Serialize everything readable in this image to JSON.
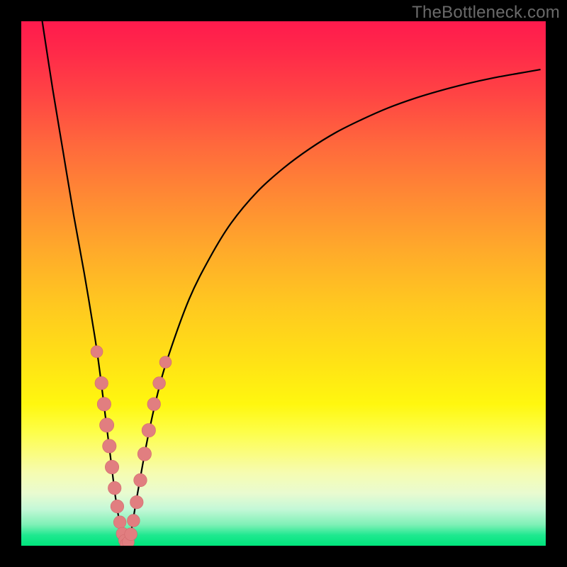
{
  "watermark": "TheBottleneck.com",
  "colors": {
    "frame": "#000000",
    "curve_stroke": "#000000",
    "dot_fill": "#e17e80",
    "dot_stroke": "#d16a6d"
  },
  "chart_data": {
    "type": "line",
    "title": "",
    "xlabel": "",
    "ylabel": "",
    "xlim": [
      0,
      100
    ],
    "ylim": [
      0,
      100
    ],
    "series": [
      {
        "name": "curve",
        "x": [
          4,
          6,
          8,
          10,
          12,
          14,
          15,
          16,
          17,
          18,
          19,
          19.5,
          20,
          20.5,
          21,
          22,
          24,
          26,
          28,
          32,
          36,
          40,
          45,
          50,
          55,
          60,
          65,
          70,
          75,
          80,
          85,
          90,
          95,
          99
        ],
        "y": [
          100,
          87,
          75,
          63,
          52,
          40,
          33,
          25,
          17,
          9,
          3,
          1,
          0,
          1,
          3,
          9,
          20,
          29,
          36,
          47,
          55,
          61.5,
          67.5,
          72,
          75.7,
          78.8,
          81.3,
          83.5,
          85.3,
          86.8,
          88.1,
          89.2,
          90.1,
          90.8
        ]
      }
    ],
    "dots": [
      {
        "x": 14.4,
        "y": 37,
        "r": 1.1
      },
      {
        "x": 15.3,
        "y": 31,
        "r": 1.3
      },
      {
        "x": 15.8,
        "y": 27,
        "r": 1.4
      },
      {
        "x": 16.3,
        "y": 23,
        "r": 1.5
      },
      {
        "x": 16.8,
        "y": 19,
        "r": 1.4
      },
      {
        "x": 17.3,
        "y": 15,
        "r": 1.4
      },
      {
        "x": 17.8,
        "y": 11,
        "r": 1.3
      },
      {
        "x": 18.3,
        "y": 7.5,
        "r": 1.3
      },
      {
        "x": 18.8,
        "y": 4.5,
        "r": 1.2
      },
      {
        "x": 19.3,
        "y": 2.3,
        "r": 1.2
      },
      {
        "x": 19.7,
        "y": 1.0,
        "r": 1.1
      },
      {
        "x": 20.0,
        "y": 0.3,
        "r": 1.1
      },
      {
        "x": 20.4,
        "y": 0.7,
        "r": 1.1
      },
      {
        "x": 20.9,
        "y": 2.2,
        "r": 1.2
      },
      {
        "x": 21.4,
        "y": 4.8,
        "r": 1.2
      },
      {
        "x": 22.0,
        "y": 8.3,
        "r": 1.3
      },
      {
        "x": 22.7,
        "y": 12.5,
        "r": 1.3
      },
      {
        "x": 23.5,
        "y": 17.5,
        "r": 1.4
      },
      {
        "x": 24.3,
        "y": 22,
        "r": 1.4
      },
      {
        "x": 25.3,
        "y": 27,
        "r": 1.3
      },
      {
        "x": 26.3,
        "y": 31,
        "r": 1.2
      },
      {
        "x": 27.5,
        "y": 35,
        "r": 1.1
      }
    ]
  }
}
